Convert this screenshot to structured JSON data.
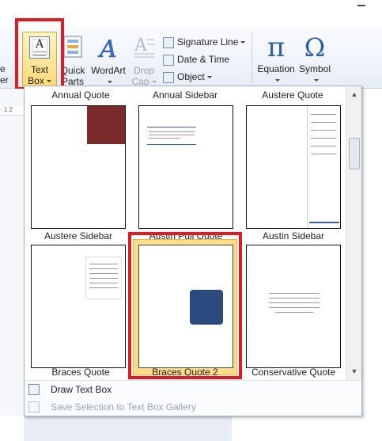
{
  "ribbon": {
    "partial_left": {
      "top": "e",
      "bottom": "er"
    },
    "text_box": {
      "line1": "Text",
      "line2": "Box",
      "icon": "text-box-icon"
    },
    "quick_parts": {
      "line1": "Quick",
      "line2": "Parts",
      "icon": "quick-parts-icon"
    },
    "wordart": {
      "line1": "WordArt",
      "icon": "wordart-icon"
    },
    "drop_cap": {
      "line1": "Drop",
      "line2": "Cap",
      "icon": "drop-cap-icon"
    },
    "signature_line": {
      "label": "Signature Line",
      "icon": "signature-line-icon"
    },
    "date_time": {
      "label": "Date & Time",
      "icon": "date-time-icon"
    },
    "object": {
      "label": "Object",
      "icon": "object-icon"
    },
    "equation": {
      "label": "Equation",
      "glyph": "π"
    },
    "symbol": {
      "label": "Symbol",
      "glyph": "Ω"
    }
  },
  "ruler": {
    "mark": "· 1 2"
  },
  "gallery": {
    "top_row_labels": [
      "Annual Quote",
      "Annual Sidebar",
      "Austere Quote"
    ],
    "items": [
      {
        "label": "Austere Sidebar"
      },
      {
        "label": "Austin Pull Quote"
      },
      {
        "label": "Austin Sidebar"
      },
      {
        "label": "Braces Quote"
      },
      {
        "label": "Braces Quote 2",
        "selected": true
      },
      {
        "label": "Conservative Quote"
      }
    ]
  },
  "menu": {
    "draw": {
      "label": "Draw Text Box",
      "accel": "D"
    },
    "save": {
      "label": "Save Selection to Text Box Gallery",
      "accel": "S"
    }
  },
  "colors": {
    "highlight": "#fddc8a",
    "annotation_red": "#e01b24",
    "accent_blue": "#3f5f9b"
  }
}
